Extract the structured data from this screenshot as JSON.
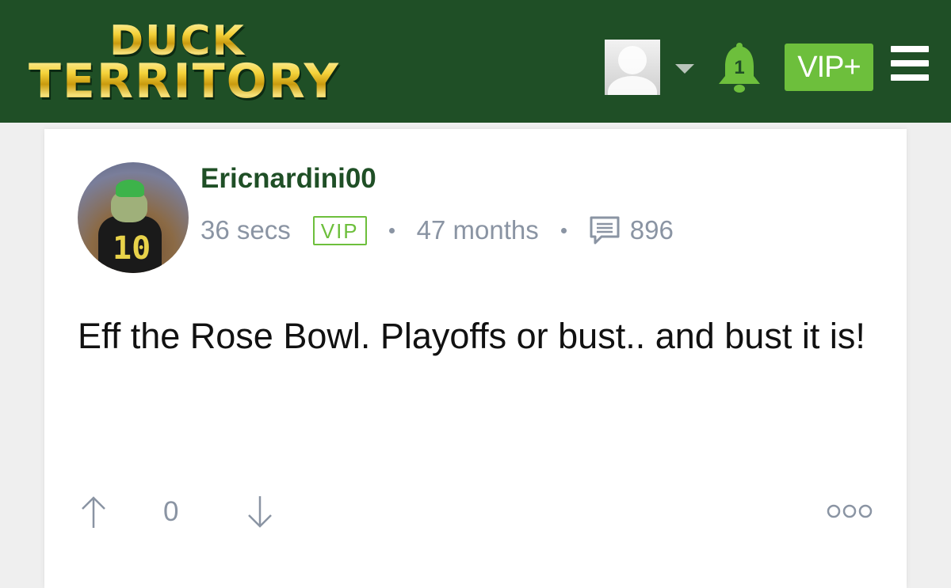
{
  "header": {
    "logo_top": "DUCK",
    "logo_bottom": "TERRITORY",
    "notification_count": "1",
    "vip_plus_label": "VIP+",
    "colors": {
      "background": "#1f4f26",
      "accent_green": "#6dbf3c"
    },
    "icons": [
      "user-avatar-placeholder",
      "chevron-down-icon",
      "bell-icon",
      "menu-icon"
    ]
  },
  "post": {
    "username": "Ericnardini00",
    "time": "36 secs",
    "badge": "VIP",
    "tenure": "47 months",
    "post_count": "896",
    "body": "Eff the Rose Bowl. Playoffs or bust.. and bust it is!",
    "votes": {
      "score": "0"
    },
    "icons": [
      "comment-count-icon",
      "upvote-icon",
      "downvote-icon",
      "more-options-icon"
    ]
  }
}
